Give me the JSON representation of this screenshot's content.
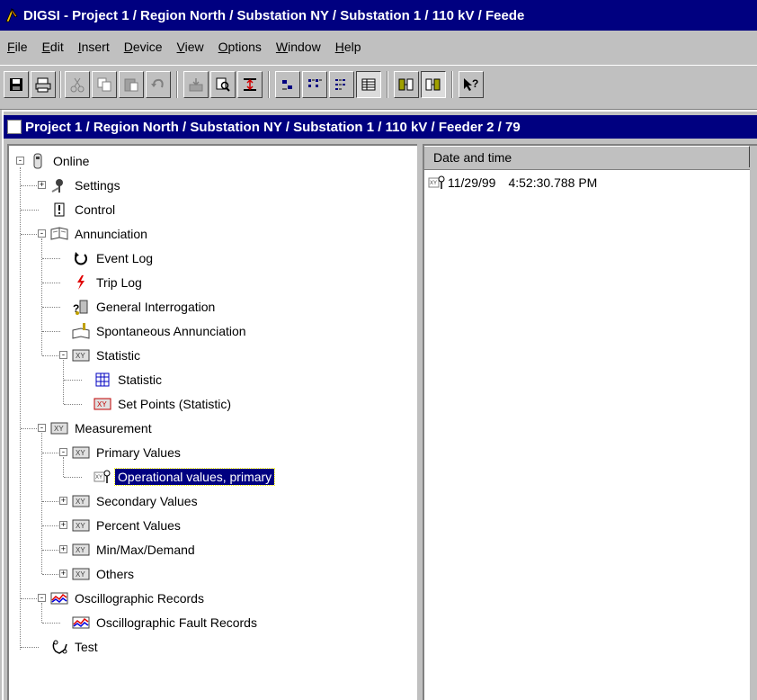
{
  "window": {
    "title": "DIGSI - Project 1 / Region North / Substation NY / Substation 1 / 110 kV / Feede"
  },
  "menu": [
    {
      "label": "File",
      "key": "F"
    },
    {
      "label": "Edit",
      "key": "E"
    },
    {
      "label": "Insert",
      "key": "I"
    },
    {
      "label": "Device",
      "key": "D"
    },
    {
      "label": "View",
      "key": "V"
    },
    {
      "label": "Options",
      "key": "O"
    },
    {
      "label": "Window",
      "key": "W"
    },
    {
      "label": "Help",
      "key": "H"
    }
  ],
  "toolbar": {
    "buttons": [
      {
        "icon": "save-icon"
      },
      {
        "icon": "print-icon"
      },
      {
        "icon": "cut-icon"
      },
      {
        "icon": "copy-icon"
      },
      {
        "icon": "paste-icon"
      },
      {
        "icon": "undo-icon"
      },
      {
        "icon": "device-import-icon"
      },
      {
        "icon": "find-icon"
      },
      {
        "icon": "level-icon"
      },
      {
        "icon": "large-icons-icon"
      },
      {
        "icon": "small-icons-icon"
      },
      {
        "icon": "list-icon"
      },
      {
        "icon": "details-icon"
      },
      {
        "icon": "offline-icon"
      },
      {
        "icon": "online-icon"
      },
      {
        "icon": "context-help-icon"
      }
    ]
  },
  "child_window": {
    "title": "Project 1 / Region North / Substation NY / Substation 1 / 110 kV / Feeder 2 / 79"
  },
  "tree": [
    {
      "label": "Online",
      "icon": "device-icon"
    },
    {
      "label": "Settings",
      "icon": "settings-icon"
    },
    {
      "label": "Control",
      "icon": "control-icon"
    },
    {
      "label": "Annunciation",
      "icon": "annunciation-icon"
    },
    {
      "label": "Event Log",
      "icon": "event-log-icon"
    },
    {
      "label": "Trip Log",
      "icon": "trip-log-icon"
    },
    {
      "label": "General Interrogation",
      "icon": "interrogation-icon"
    },
    {
      "label": "Spontaneous Annunciation",
      "icon": "spontaneous-icon"
    },
    {
      "label": "Statistic",
      "icon": "statistic-folder-icon"
    },
    {
      "label": "Statistic",
      "icon": "grid-icon"
    },
    {
      "label": "Set Points (Statistic)",
      "icon": "setpoints-icon"
    },
    {
      "label": "Measurement",
      "icon": "measurement-icon"
    },
    {
      "label": "Primary Values",
      "icon": "measurement-icon"
    },
    {
      "label": "Operational values, primary",
      "icon": "operational-icon"
    },
    {
      "label": "Secondary Values",
      "icon": "measurement-icon"
    },
    {
      "label": "Percent Values",
      "icon": "measurement-icon"
    },
    {
      "label": "Min/Max/Demand",
      "icon": "measurement-icon"
    },
    {
      "label": "Others",
      "icon": "measurement-icon"
    },
    {
      "label": "Oscillographic Records",
      "icon": "oscillograph-icon"
    },
    {
      "label": "Oscillographic Fault Records",
      "icon": "oscillograph-icon"
    },
    {
      "label": "Test",
      "icon": "test-icon"
    }
  ],
  "list": {
    "columns": [
      "Date and time"
    ],
    "rows": [
      {
        "date": "11/29/99",
        "time": "4:52:30.788 PM",
        "icon": "operational-icon"
      }
    ]
  }
}
